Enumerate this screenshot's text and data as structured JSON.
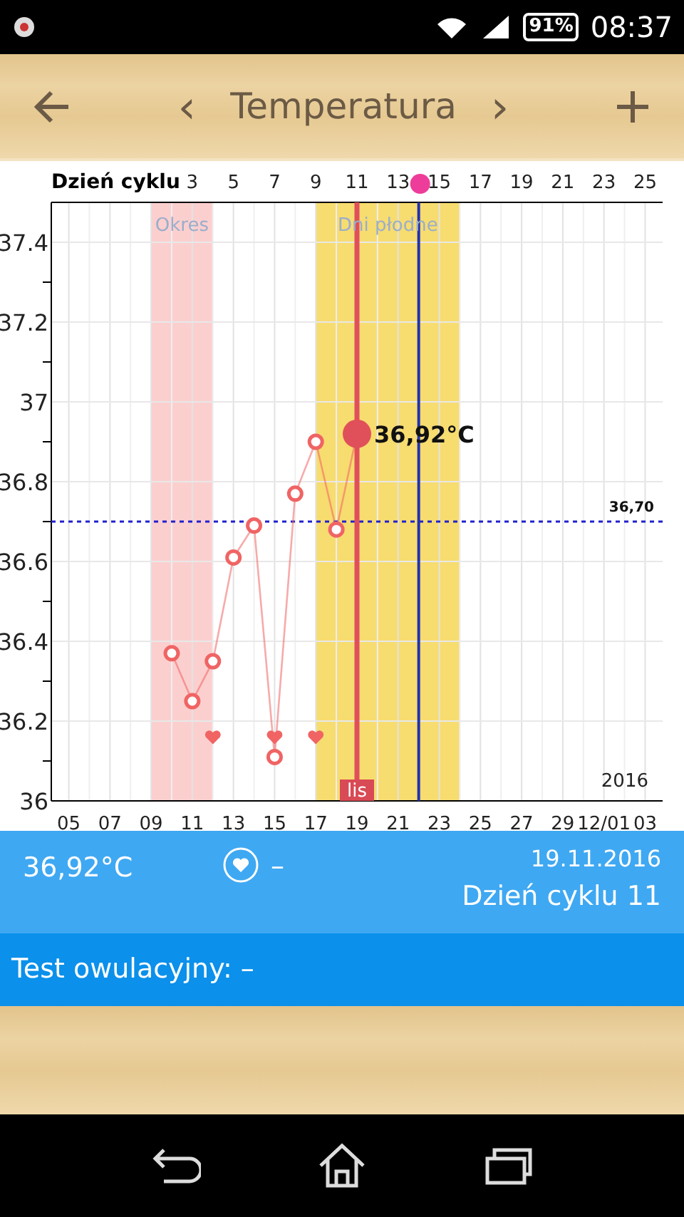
{
  "status_bar": {
    "battery": "91%",
    "time": "08:37"
  },
  "toolbar": {
    "title": "Temperatura",
    "prev": "‹",
    "next": "›"
  },
  "chart": {
    "date_ticks": [
      "05",
      "07",
      "09",
      "11",
      "13",
      "15",
      "17",
      "19",
      "21",
      "23",
      "25",
      "27",
      "29",
      "12/01",
      "03"
    ],
    "year": "2016",
    "chart_data": {
      "type": "line",
      "xlabel": "Dzień cyklu",
      "grid": true,
      "xlim": [
        -3.85,
        25.85
      ],
      "ylim": [
        36,
        37.5
      ],
      "xticks": [
        3,
        5,
        7,
        9,
        11,
        13,
        15,
        17,
        19,
        21,
        23,
        25
      ],
      "yticks": [
        {
          "value": 36,
          "label": "36"
        },
        {
          "value": 36.2,
          "label": "36.2"
        },
        {
          "value": 36.4,
          "label": "36.4"
        },
        {
          "value": 36.6,
          "label": "36.6"
        },
        {
          "value": 36.8,
          "label": "36.8"
        },
        {
          "value": 37,
          "label": "37"
        },
        {
          "value": 37.2,
          "label": "37.2"
        },
        {
          "value": 37.4,
          "label": "37.4"
        }
      ],
      "x": [
        2,
        3,
        4,
        5,
        6,
        7,
        8,
        9,
        10,
        11
      ],
      "series": [
        {
          "color": "#f06464",
          "marker": "o",
          "values": [
            36.37,
            36.25,
            36.35,
            36.61,
            36.69,
            36.11,
            36.77,
            36.9,
            36.68,
            36.92
          ]
        }
      ],
      "bands": [
        {
          "axis": "x",
          "from": 1,
          "to": 4,
          "label": "Okres",
          "color": "#fccfcf"
        },
        {
          "axis": "x",
          "from": 9,
          "to": 16,
          "label": "Dni płodne",
          "color": "#f7dc70"
        }
      ],
      "ref_lines": [
        {
          "axis": "y",
          "value": 36.7,
          "label": "36,70",
          "color": "#2020d0"
        },
        {
          "axis": "x",
          "value": 14,
          "color": "#2030b0"
        },
        {
          "axis": "x",
          "value": 11,
          "color": "#e0505a"
        }
      ],
      "annotations": [
        {
          "x": 11,
          "y": 36.92,
          "text": "36,92°C"
        },
        {
          "x": 11,
          "text": "lis"
        }
      ]
    },
    "intercourse_marks": [
      false,
      false,
      true,
      false,
      false,
      true,
      false,
      true,
      false,
      false
    ]
  },
  "summary": {
    "temperature": "36,92°C",
    "intercourse": "–",
    "date": "19.11.2016",
    "cycle_day": "Dzień cyklu 11"
  },
  "ovulation_test": {
    "label": "Test owulacyjny: –"
  }
}
